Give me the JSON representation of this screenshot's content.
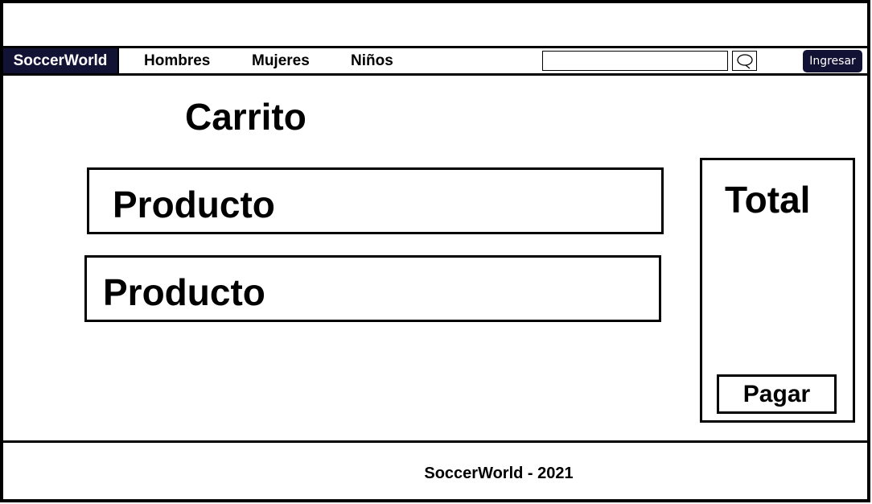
{
  "nav": {
    "brand": "SoccerWorld",
    "links": [
      "Hombres",
      "Mujeres",
      "Niños"
    ],
    "search": {
      "value": "",
      "placeholder": "",
      "icon": "search-icon"
    },
    "login_label": "Ingresar"
  },
  "main": {
    "title": "Carrito",
    "products": [
      "Producto",
      "Producto"
    ],
    "summary": {
      "total_label": "Total",
      "pay_label": "Pagar"
    }
  },
  "footer": {
    "text": "SoccerWorld - 2021"
  },
  "colors": {
    "brand_bg": "#121235",
    "text": "#000000",
    "background": "#ffffff"
  }
}
